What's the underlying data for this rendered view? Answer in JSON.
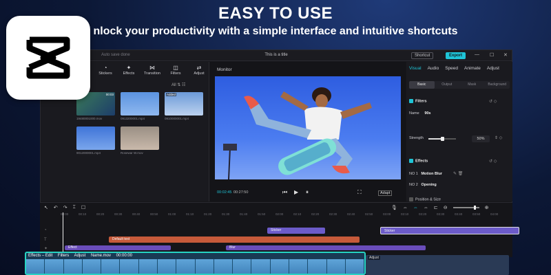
{
  "promo": {
    "headline": "EASY TO USE",
    "subline": "nlock your productivity with a simple interface and intuitive shortcuts"
  },
  "titlebar": {
    "left_text": "Auto save done",
    "title": "This is a title",
    "shortcut_label": "Shortcut",
    "export_label": "Export"
  },
  "toolbar": {
    "items": [
      {
        "label": "Stickers",
        "icon": "sticker-icon"
      },
      {
        "label": "Effects",
        "icon": "effects-icon"
      },
      {
        "label": "Transition",
        "icon": "transition-icon"
      },
      {
        "label": "Filters",
        "icon": "filters-icon"
      },
      {
        "label": "Adjust",
        "icon": "adjust-icon"
      }
    ]
  },
  "media": {
    "filter_label": "All",
    "thumbs": [
      {
        "caption": "19480001000.mov",
        "badge": "",
        "duration": "00:03"
      },
      {
        "caption": "0913200001.mp4",
        "badge": "",
        "duration": ""
      },
      {
        "caption": "0910000001.mp4",
        "badge": "Added",
        "duration": ""
      },
      {
        "caption": "9012000001.mp4",
        "badge": "",
        "duration": ""
      },
      {
        "caption": "Rosewar W.mov",
        "badge": "",
        "duration": ""
      }
    ]
  },
  "monitor": {
    "label": "Monitor",
    "current_time": "00:02:45",
    "total_time": "00:27:50",
    "adapt_label": "Adapt"
  },
  "inspector": {
    "tabs": [
      "Visual",
      "Audio",
      "Speed",
      "Animate",
      "Adjust"
    ],
    "active_tab": "Visual",
    "subtabs": [
      "Basic",
      "Output",
      "Mask",
      "Background"
    ],
    "active_subtab": "Basic",
    "filters_section": "Filters",
    "name_label": "Name",
    "name_value": "90s",
    "strength_label": "Strength",
    "strength_value": "50%",
    "strength_fraction": 0.5,
    "effects_section": "Effects",
    "effect1_label": "NO 1",
    "effect1_value": "Motion Blur",
    "effect2_label": "NO 2",
    "effect2_value": "Opening",
    "position_section": "Position & Size"
  },
  "timeline": {
    "ruler": [
      "00:00",
      "00:10",
      "00:20",
      "00:30",
      "00:40",
      "00:50",
      "01:00",
      "01:10",
      "01:20",
      "01:30",
      "01:40",
      "01:50",
      "02:00",
      "02:10",
      "02:20",
      "02:30",
      "02:40",
      "02:50",
      "03:00",
      "03:10",
      "03:20",
      "03:30",
      "03:40",
      "03:50",
      "04:00"
    ],
    "sticker1": "Sticker",
    "sticker2": "Sticker",
    "text_clip": "Default text",
    "effect1": "Effect",
    "effect2": "Blur",
    "strip_effects": "Effects – Edit",
    "strip_filters": "Filters",
    "strip_adjust": "Adjust",
    "strip_name": "Name.mov",
    "strip_time": "00:00:00",
    "strip2_label": "Adjust"
  },
  "colors": {
    "accent": "#1fc4d6",
    "sticker_clip": "#6c5bc9",
    "text_clip": "#c65a3a",
    "strip_border": "#27d3c3"
  }
}
